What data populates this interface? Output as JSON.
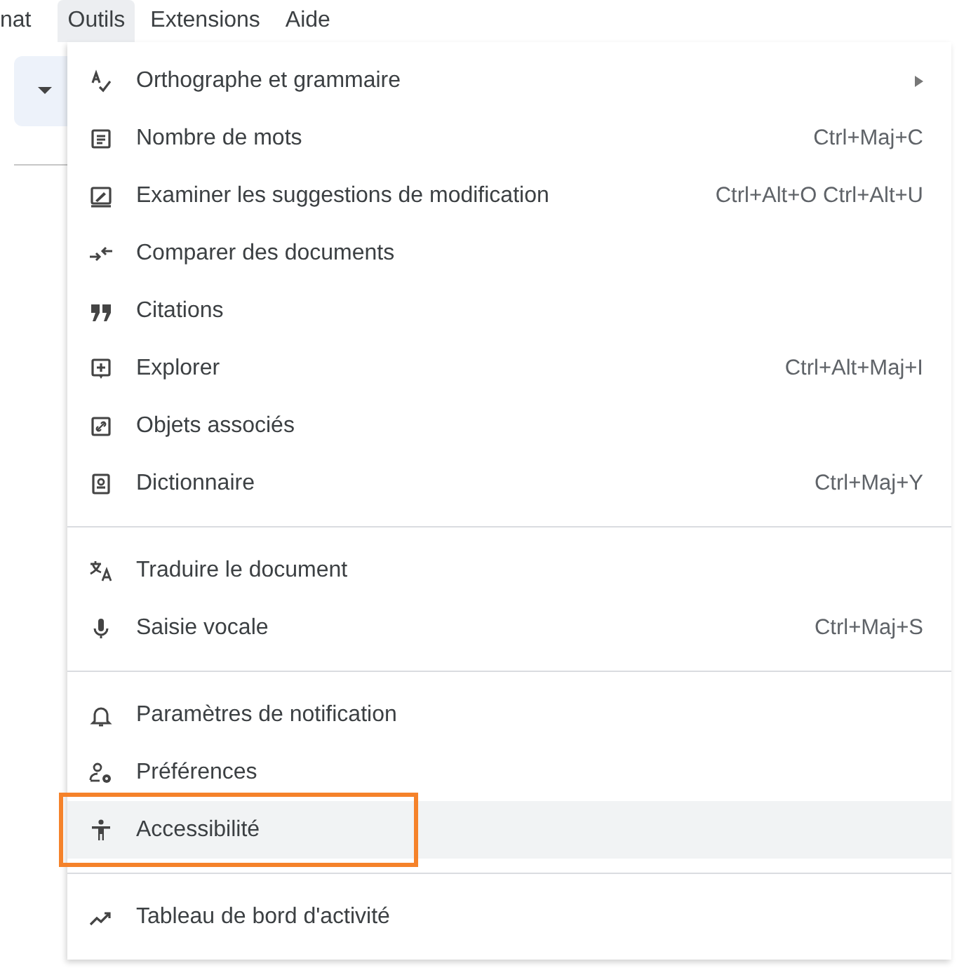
{
  "menubar": [
    {
      "label": "nat",
      "selected": false
    },
    {
      "label": "Outils",
      "selected": true
    },
    {
      "label": "Extensions",
      "selected": false
    },
    {
      "label": "Aide",
      "selected": false
    }
  ],
  "menu": {
    "groups": [
      {
        "items": [
          {
            "label": "Orthographe et grammaire",
            "submenu": true,
            "selected": false,
            "outlined": false
          },
          {
            "label": "Nombre de mots",
            "shortcut": "Ctrl+Maj+C",
            "submenu": false,
            "selected": false,
            "outlined": false
          },
          {
            "label": "Examiner les suggestions de modification",
            "shortcut": "Ctrl+Alt+O Ctrl+Alt+U",
            "submenu": false,
            "selected": false,
            "outlined": false
          },
          {
            "label": "Comparer des documents",
            "submenu": false,
            "selected": false,
            "outlined": false
          },
          {
            "label": "Citations",
            "submenu": false,
            "selected": false,
            "outlined": false
          },
          {
            "label": "Explorer",
            "shortcut": "Ctrl+Alt+Maj+I",
            "submenu": false,
            "selected": false,
            "outlined": false
          },
          {
            "label": "Objets associés",
            "submenu": false,
            "selected": false,
            "outlined": false
          },
          {
            "label": "Dictionnaire",
            "shortcut": "Ctrl+Maj+Y",
            "submenu": false,
            "selected": false,
            "outlined": false
          }
        ]
      },
      {
        "items": [
          {
            "label": "Traduire le document",
            "submenu": false,
            "selected": false,
            "outlined": false
          },
          {
            "label": "Saisie vocale",
            "shortcut": "Ctrl+Maj+S",
            "submenu": false,
            "selected": false,
            "outlined": false
          }
        ]
      },
      {
        "items": [
          {
            "label": "Paramètres de notification",
            "submenu": false,
            "selected": false,
            "outlined": false
          },
          {
            "label": "Préférences",
            "submenu": false,
            "selected": false,
            "outlined": false
          },
          {
            "label": "Accessibilité",
            "submenu": false,
            "selected": true,
            "outlined": true
          }
        ]
      },
      {
        "items": [
          {
            "label": "Tableau de bord d'activité",
            "submenu": false,
            "selected": false,
            "outlined": false
          }
        ]
      }
    ]
  }
}
